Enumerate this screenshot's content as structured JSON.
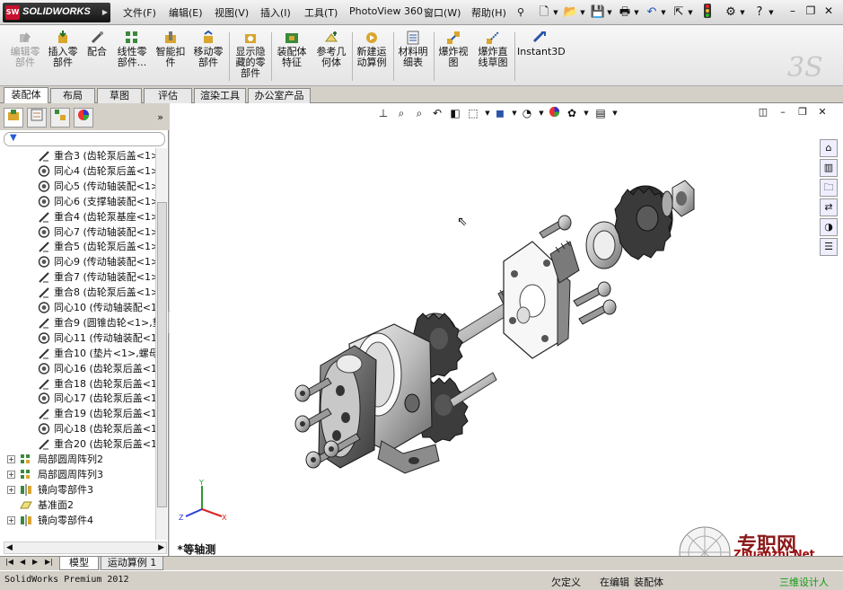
{
  "app": {
    "logo_text": "SOLIDWORKS"
  },
  "menu": {
    "items": [
      "文件(F)",
      "编辑(E)",
      "视图(V)",
      "插入(I)",
      "工具(T)",
      "PhotoView 360",
      "窗口(W)",
      "帮助(H)"
    ]
  },
  "ribbon": {
    "buttons": [
      {
        "label": "编辑零部件",
        "icon": "edit-component-icon"
      },
      {
        "label": "插入零部件",
        "icon": "insert-component-icon"
      },
      {
        "label": "配合",
        "icon": "mate-icon"
      },
      {
        "label": "线性零部件...",
        "icon": "linear-pattern-icon"
      },
      {
        "label": "智能扣件",
        "icon": "smart-fasteners-icon"
      },
      {
        "label": "移动零部件",
        "icon": "move-component-icon"
      },
      {
        "label": "显示隐藏的零部件",
        "icon": "show-hidden-icon"
      },
      {
        "label": "装配体特征",
        "icon": "assembly-features-icon"
      },
      {
        "label": "参考几何体",
        "icon": "reference-geometry-icon"
      },
      {
        "label": "新建运动算例",
        "icon": "new-motion-study-icon"
      },
      {
        "label": "材料明细表",
        "icon": "bill-of-materials-icon"
      },
      {
        "label": "爆炸视图",
        "icon": "exploded-view-icon"
      },
      {
        "label": "爆炸直线草图",
        "icon": "explode-line-sketch-icon"
      },
      {
        "label": "Instant3D",
        "icon": "instant3d-icon"
      }
    ]
  },
  "tabs": [
    "装配体",
    "布局",
    "草图",
    "评估",
    "渲染工具",
    "办公室产品"
  ],
  "tree": {
    "items": [
      {
        "kind": "coincident",
        "label": "重合3 (齿轮泵后盖<1>"
      },
      {
        "kind": "concentric",
        "label": "同心4 (齿轮泵后盖<1>"
      },
      {
        "kind": "concentric",
        "label": "同心5 (传动轴装配<1>"
      },
      {
        "kind": "concentric",
        "label": "同心6 (支撑轴装配<1>"
      },
      {
        "kind": "coincident",
        "label": "重合4 (齿轮泵基座<1>"
      },
      {
        "kind": "concentric",
        "label": "同心7 (传动轴装配<1>"
      },
      {
        "kind": "coincident",
        "label": "重合5 (齿轮泵后盖<1>"
      },
      {
        "kind": "concentric",
        "label": "同心9 (传动轴装配<1>"
      },
      {
        "kind": "coincident",
        "label": "重合7 (传动轴装配<1>"
      },
      {
        "kind": "coincident",
        "label": "重合8 (齿轮泵后盖<1>"
      },
      {
        "kind": "concentric",
        "label": "同心10 (传动轴装配<1"
      },
      {
        "kind": "coincident",
        "label": "重合9 (圆锥齿轮<1>,垫"
      },
      {
        "kind": "concentric",
        "label": "同心11 (传动轴装配<1"
      },
      {
        "kind": "coincident",
        "label": "重合10 (垫片<1>,螺母"
      },
      {
        "kind": "concentric",
        "label": "同心16 (齿轮泵后盖<1"
      },
      {
        "kind": "coincident",
        "label": "重合18 (齿轮泵后盖<1"
      },
      {
        "kind": "concentric",
        "label": "同心17 (齿轮泵后盖<1"
      },
      {
        "kind": "coincident",
        "label": "重合19 (齿轮泵后盖<1"
      },
      {
        "kind": "concentric",
        "label": "同心18 (齿轮泵后盖<1"
      },
      {
        "kind": "coincident",
        "label": "重合20 (齿轮泵后盖<1"
      }
    ],
    "features": [
      {
        "kind": "pattern",
        "label": "局部圆周阵列2",
        "expander": "+"
      },
      {
        "kind": "pattern",
        "label": "局部圆周阵列3",
        "expander": "+"
      },
      {
        "kind": "mirror",
        "label": "镜向零部件3",
        "expander": "+"
      },
      {
        "kind": "plane",
        "label": "基准面2",
        "expander": ""
      },
      {
        "kind": "mirror",
        "label": "镜向零部件4",
        "expander": "+"
      }
    ]
  },
  "bottom_tabs": [
    "模型",
    "运动算例 1"
  ],
  "status": {
    "product": "SolidWorks Premium 2012",
    "defined": "欠定义",
    "editing": "在编辑",
    "doc_type": "装配体"
  },
  "graphics": {
    "view_label": "*等轴测",
    "triad": {
      "x": "X",
      "y": "Y",
      "z": "Z"
    }
  },
  "watermark": {
    "cn": "专职网",
    "en": "Zhuanzhi.Net",
    "sub": "三维设计人"
  }
}
